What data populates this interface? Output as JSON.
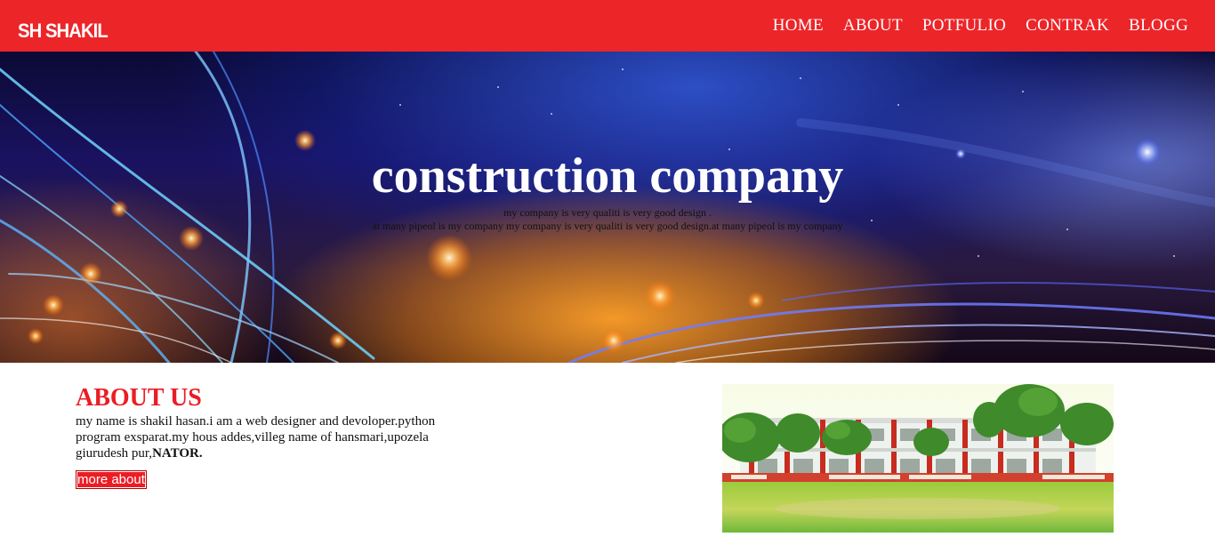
{
  "header": {
    "logo": "SH SHAKIL",
    "nav": [
      "HOME",
      "ABOUT",
      "POTFULIO",
      "CONTRAK",
      "BLOGG"
    ],
    "background": "#ec2529"
  },
  "hero": {
    "title": "construction company",
    "subtitle_line1": "my company is very qualiti is very good design .",
    "subtitle_line2": "at many pipeol is my company my company is very qualiti is very good design.at many pipeol is my company"
  },
  "about": {
    "title": "ABOUT US",
    "text": "my name is shakil hasan.i am a web designer and devoloper.python program exsparat.my hous addes,villeg name of hansmari,upozela giurudesh pur,",
    "text_bold": "NATOR.",
    "button": "more about",
    "accent": "#ec1c24"
  }
}
